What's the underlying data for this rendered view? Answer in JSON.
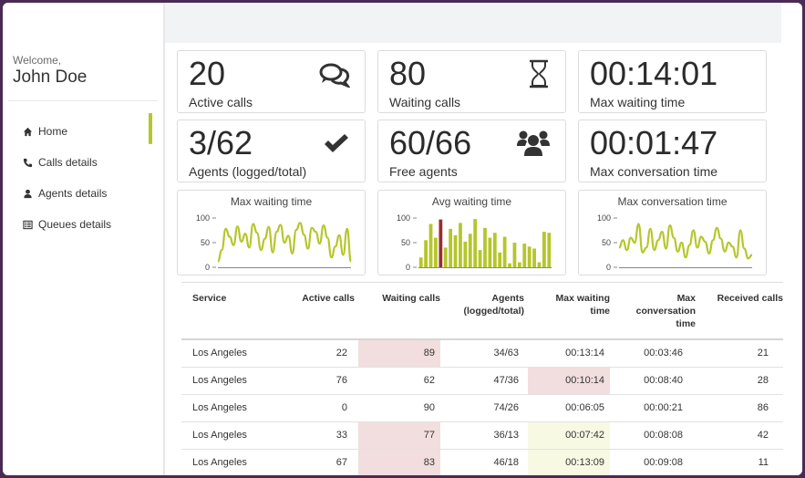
{
  "sidebar": {
    "welcome": "Welcome,",
    "user": "John Doe",
    "items": [
      {
        "label": "Home",
        "icon": "home-icon"
      },
      {
        "label": "Calls details",
        "icon": "phone-icon"
      },
      {
        "label": "Agents details",
        "icon": "user-icon"
      },
      {
        "label": "Queues details",
        "icon": "list-icon"
      }
    ],
    "active_index": 0
  },
  "colors": {
    "accent": "#b5c62b",
    "highlight_bar": "#9b2d2d",
    "pink_cell": "#f2dede",
    "cream_cell": "#f8f9e3"
  },
  "stats": [
    {
      "value": "20",
      "label": "Active calls",
      "icon": "comments-icon"
    },
    {
      "value": "80",
      "label": "Waiting calls",
      "icon": "hourglass-icon"
    },
    {
      "value": "00:14:01",
      "label": "Max waiting time",
      "icon": ""
    },
    {
      "value": "3/62",
      "label": "Agents (logged/total)",
      "icon": "check-icon"
    },
    {
      "value": "60/66",
      "label": "Free agents",
      "icon": "users-icon"
    },
    {
      "value": "00:01:47",
      "label": "Max conversation time",
      "icon": ""
    }
  ],
  "chart_data": [
    {
      "type": "line",
      "title": "Max waiting time",
      "ylim": [
        0,
        100
      ],
      "yticks": [
        "100",
        "50",
        "0"
      ],
      "values": [
        12,
        35,
        78,
        62,
        45,
        83,
        52,
        68,
        40,
        88,
        70,
        35,
        58,
        82,
        30,
        72,
        86,
        50,
        64,
        28,
        76,
        90,
        66,
        38,
        80,
        72,
        48,
        85,
        60,
        20,
        42,
        65,
        25,
        78,
        12
      ]
    },
    {
      "type": "bar",
      "title": "Avg waiting time",
      "ylim": [
        0,
        100
      ],
      "yticks": [
        "100",
        "50",
        "0"
      ],
      "values": [
        20,
        55,
        88,
        60,
        97,
        40,
        78,
        65,
        90,
        52,
        68,
        98,
        35,
        80,
        60,
        70,
        30,
        62,
        8,
        50,
        10,
        48,
        42,
        38,
        10,
        72,
        70
      ],
      "highlight_index": 4
    },
    {
      "type": "line",
      "title": "Max conversation time",
      "ylim": [
        0,
        100
      ],
      "yticks": [
        "100",
        "50",
        "0"
      ],
      "values": [
        40,
        55,
        35,
        60,
        50,
        88,
        30,
        40,
        78,
        35,
        55,
        72,
        38,
        85,
        60,
        32,
        50,
        20,
        45,
        75,
        40,
        62,
        52,
        28,
        55,
        80,
        58,
        32,
        50,
        42,
        20,
        75,
        38,
        18,
        25
      ]
    }
  ],
  "table": {
    "headers": [
      "Service",
      "Active calls",
      "Waiting calls",
      "Agents (logged/total)",
      "Max waiting time",
      "Max conversation time",
      "Received calls"
    ],
    "rows": [
      {
        "service": "Los Angeles",
        "active": "22",
        "waiting": "89",
        "agents": "34/63",
        "max_wait": "00:13:14",
        "max_conv": "00:03:46",
        "received": "21",
        "waiting_hl": "pink",
        "wait_hl": ""
      },
      {
        "service": "Los Angeles",
        "active": "76",
        "waiting": "62",
        "agents": "47/36",
        "max_wait": "00:10:14",
        "max_conv": "00:08:40",
        "received": "28",
        "waiting_hl": "",
        "wait_hl": "pink"
      },
      {
        "service": "Los Angeles",
        "active": "0",
        "waiting": "90",
        "agents": "74/26",
        "max_wait": "00:06:05",
        "max_conv": "00:00:21",
        "received": "86",
        "waiting_hl": "",
        "wait_hl": ""
      },
      {
        "service": "Los Angeles",
        "active": "33",
        "waiting": "77",
        "agents": "36/13",
        "max_wait": "00:07:42",
        "max_conv": "00:08:08",
        "received": "42",
        "waiting_hl": "pink",
        "wait_hl": "cream"
      },
      {
        "service": "Los Angeles",
        "active": "67",
        "waiting": "83",
        "agents": "46/18",
        "max_wait": "00:13:09",
        "max_conv": "00:09:08",
        "received": "11",
        "waiting_hl": "pink",
        "wait_hl": "cream"
      }
    ]
  }
}
